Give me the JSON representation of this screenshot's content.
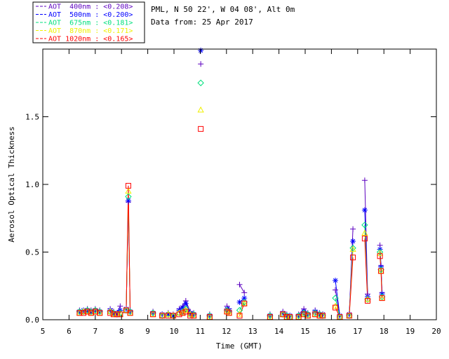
{
  "header": {
    "title_line1": "PML, N 50 22', W 04 08', Alt 0m",
    "title_line2": "Data from: 25 Apr 2017"
  },
  "legend": {
    "entries": [
      {
        "label": "AOT  400nm : <0.208>",
        "wavelength": "400nm",
        "mean": "<0.208>",
        "color": "#5C00C0",
        "symbol": "plus"
      },
      {
        "label": "AOT  500nm : <0.200>",
        "wavelength": "500nm",
        "mean": "<0.200>",
        "color": "#0000FF",
        "symbol": "asterisk"
      },
      {
        "label": "AOT  675nm : <0.181>",
        "wavelength": "675nm",
        "mean": "<0.181>",
        "color": "#00E07D",
        "symbol": "diamond"
      },
      {
        "label": "AOT  870nm : <0.171>",
        "wavelength": "870nm",
        "mean": "<0.171>",
        "color": "#F0F000",
        "symbol": "triangle"
      },
      {
        "label": "AOT 1020nm : <0.165>",
        "wavelength": "1020nm",
        "mean": "<0.165>",
        "color": "#FF0000",
        "symbol": "square"
      }
    ]
  },
  "chart_data": {
    "type": "scatter",
    "title": "PML, N 50 22', W 04 08', Alt 0m",
    "subtitle": "Data from: 25 Apr 2017",
    "xlabel": "Time (GMT)",
    "ylabel": "Aerosol Optical Thickness",
    "xlim": [
      5,
      20
    ],
    "ylim": [
      0,
      2.0
    ],
    "xticks": [
      5,
      6,
      7,
      8,
      9,
      10,
      11,
      12,
      13,
      14,
      15,
      16,
      17,
      18,
      19,
      20
    ],
    "yticks": [
      0.0,
      0.5,
      1.0,
      1.5
    ],
    "ytick_labels": [
      "0.0",
      "0.5",
      "1.0",
      "1.5"
    ],
    "grid": false,
    "legend_position": "top-left",
    "series_names": [
      "AOT 400nm",
      "AOT 500nm",
      "AOT 675nm",
      "AOT 870nm",
      "AOT 1020nm"
    ],
    "series_colors": [
      "#5C00C0",
      "#0000FF",
      "#00E07D",
      "#F0F000",
      "#FF0000"
    ],
    "series_symbols": [
      "plus",
      "asterisk",
      "diamond",
      "triangle",
      "square"
    ],
    "connect_gap_hours": 0.2,
    "measurements": [
      {
        "t": 6.4,
        "values": [
          0.07,
          0.06,
          0.06,
          0.05,
          0.05
        ]
      },
      {
        "t": 6.55,
        "values": [
          0.07,
          0.07,
          0.06,
          0.06,
          0.05
        ]
      },
      {
        "t": 6.7,
        "values": [
          0.08,
          0.07,
          0.07,
          0.06,
          0.06
        ]
      },
      {
        "t": 6.84,
        "values": [
          0.07,
          0.06,
          0.06,
          0.05,
          0.05
        ]
      },
      {
        "t": 7.0,
        "values": [
          0.08,
          0.07,
          0.07,
          0.06,
          0.06
        ]
      },
      {
        "t": 7.17,
        "values": [
          0.07,
          0.06,
          0.06,
          0.05,
          0.05
        ]
      },
      {
        "t": 7.57,
        "values": [
          0.08,
          0.07,
          0.06,
          0.06,
          0.05
        ]
      },
      {
        "t": 7.7,
        "values": [
          0.06,
          0.05,
          0.05,
          0.04,
          0.04
        ]
      },
      {
        "t": 7.83,
        "values": [
          0.05,
          0.05,
          0.04,
          0.04,
          0.04
        ]
      },
      {
        "t": 7.95,
        "values": [
          0.1,
          0.07,
          0.05,
          0.04,
          0.04
        ]
      },
      {
        "t": 8.18,
        "values": [
          0.08,
          0.08,
          0.07,
          0.07,
          0.07
        ]
      },
      {
        "t": 8.26,
        "values": [
          0.87,
          0.88,
          0.91,
          0.95,
          0.99
        ]
      },
      {
        "t": 8.33,
        "values": [
          0.07,
          0.06,
          0.06,
          0.05,
          0.05
        ]
      },
      {
        "t": 9.2,
        "values": [
          0.06,
          0.05,
          0.05,
          0.04,
          0.04
        ]
      },
      {
        "t": 9.55,
        "values": [
          0.04,
          0.04,
          0.03,
          0.03,
          0.03
        ]
      },
      {
        "t": 9.78,
        "values": [
          0.05,
          0.04,
          0.04,
          0.04,
          0.03
        ]
      },
      {
        "t": 9.97,
        "values": [
          0.04,
          0.03,
          0.03,
          0.03,
          0.03
        ]
      },
      {
        "t": 10.2,
        "values": [
          0.08,
          0.07,
          0.05,
          0.05,
          0.04
        ]
      },
      {
        "t": 10.33,
        "values": [
          0.1,
          0.09,
          0.06,
          0.05,
          0.05
        ]
      },
      {
        "t": 10.45,
        "values": [
          0.14,
          0.12,
          0.08,
          0.07,
          0.06
        ]
      },
      {
        "t": 10.62,
        "values": [
          0.06,
          0.05,
          0.04,
          0.04,
          0.03
        ]
      },
      {
        "t": 10.75,
        "values": [
          0.05,
          0.04,
          0.04,
          0.03,
          0.03
        ]
      },
      {
        "t": 11.02,
        "values": [
          1.89,
          1.99,
          1.75,
          1.55,
          1.41
        ]
      },
      {
        "t": 11.36,
        "values": [
          0.04,
          0.03,
          0.03,
          0.02,
          0.02
        ]
      },
      {
        "t": 12.02,
        "values": [
          0.1,
          0.08,
          0.07,
          0.06,
          0.06
        ]
      },
      {
        "t": 12.1,
        "values": [
          0.08,
          0.07,
          0.06,
          0.05,
          0.05
        ]
      },
      {
        "t": 12.5,
        "values": [
          0.26,
          0.13,
          0.07,
          0.04,
          0.03
        ]
      },
      {
        "t": 12.68,
        "values": [
          0.2,
          0.16,
          0.13,
          0.12,
          0.12
        ]
      },
      {
        "t": 13.66,
        "values": [
          0.04,
          0.03,
          0.03,
          0.02,
          0.02
        ]
      },
      {
        "t": 14.15,
        "values": [
          0.06,
          0.05,
          0.04,
          0.04,
          0.04
        ]
      },
      {
        "t": 14.3,
        "values": [
          0.04,
          0.03,
          0.03,
          0.02,
          0.02
        ]
      },
      {
        "t": 14.42,
        "values": [
          0.03,
          0.03,
          0.02,
          0.02,
          0.02
        ]
      },
      {
        "t": 14.75,
        "values": [
          0.04,
          0.03,
          0.03,
          0.02,
          0.02
        ]
      },
      {
        "t": 14.95,
        "values": [
          0.08,
          0.06,
          0.05,
          0.04,
          0.04
        ]
      },
      {
        "t": 15.1,
        "values": [
          0.05,
          0.04,
          0.04,
          0.03,
          0.03
        ]
      },
      {
        "t": 15.38,
        "values": [
          0.07,
          0.06,
          0.05,
          0.04,
          0.04
        ]
      },
      {
        "t": 15.55,
        "values": [
          0.05,
          0.04,
          0.04,
          0.03,
          0.03
        ]
      },
      {
        "t": 15.67,
        "values": [
          0.04,
          0.04,
          0.03,
          0.03,
          0.03
        ]
      },
      {
        "t": 16.15,
        "values": [
          0.22,
          0.29,
          0.16,
          0.1,
          0.09
        ]
      },
      {
        "t": 16.32,
        "values": [
          0.03,
          0.03,
          0.02,
          0.02,
          0.02
        ]
      },
      {
        "t": 16.68,
        "values": [
          0.04,
          0.04,
          0.03,
          0.03,
          0.03
        ]
      },
      {
        "t": 16.82,
        "values": [
          0.67,
          0.58,
          0.53,
          0.52,
          0.46
        ]
      },
      {
        "t": 17.27,
        "values": [
          1.03,
          0.81,
          0.7,
          0.64,
          0.6
        ]
      },
      {
        "t": 17.38,
        "values": [
          0.19,
          0.17,
          0.15,
          0.15,
          0.14
        ]
      },
      {
        "t": 17.85,
        "values": [
          0.55,
          0.52,
          0.5,
          0.49,
          0.47
        ]
      },
      {
        "t": 17.89,
        "values": [
          0.4,
          0.39,
          0.37,
          0.36,
          0.36
        ]
      },
      {
        "t": 17.93,
        "values": [
          0.2,
          0.19,
          0.17,
          0.16,
          0.16
        ]
      }
    ]
  }
}
